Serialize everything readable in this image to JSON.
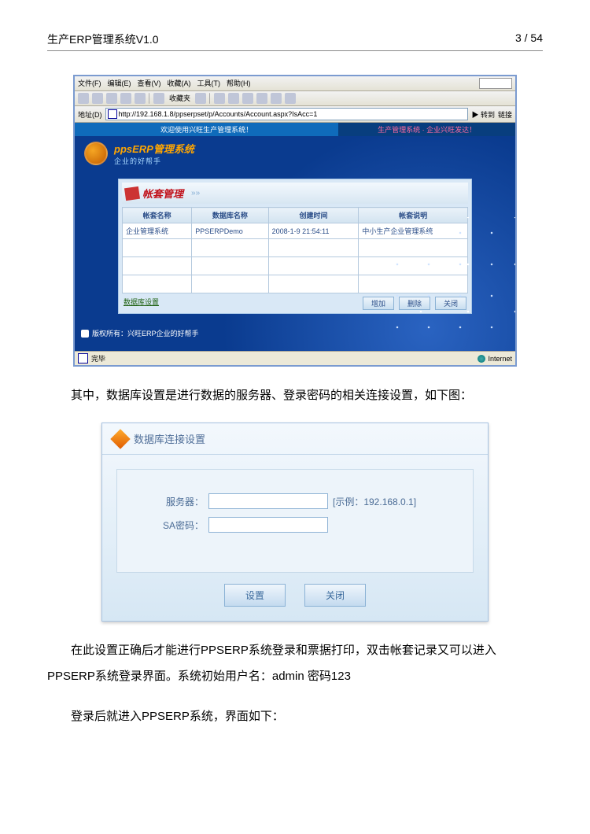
{
  "page_header": {
    "title": "生产ERP管理系统V1.0",
    "page_of": "3 / 54"
  },
  "ie": {
    "menus": [
      "文件(F)",
      "编辑(E)",
      "查看(V)",
      "收藏(A)",
      "工具(T)",
      "帮助(H)"
    ],
    "favorites_label": "收藏夹",
    "address_label": "地址(D)",
    "url": "http://192.168.1.8/ppserpset/p/Accounts/Account.aspx?IsAcc=1",
    "go_label": "转到",
    "links_label": "链接",
    "banner_left": "欢迎使用兴旺生产管理系统！",
    "banner_right": "生产管理系统 · 企业兴旺发达！",
    "brand_main": "ppsERP管理系统",
    "brand_sub": "企业的好帮手",
    "panel_title": "帐套管理",
    "table": {
      "headers": [
        "帐套名称",
        "数据库名称",
        "创建时间",
        "帐套说明"
      ],
      "row": {
        "account_name": "企业管理系统",
        "db_name": "PPSERPDemo",
        "created": "2008-1-9 21:54:11",
        "desc": "中小生产企业管理系统"
      }
    },
    "bottom_link": "数据库设置",
    "buttons": {
      "add": "增加",
      "delete": "删除",
      "close": "关闭"
    },
    "copyright": "版权所有：兴旺ERP企业的好帮手",
    "status_done": "完毕",
    "status_zone": "Internet"
  },
  "paragraphs": {
    "p1": "其中，数据库设置是进行数据的服务器、登录密码的相关连接设置，如下图：",
    "p2": "在此设置正确后才能进行PPSERP系统登录和票据打印，双击帐套记录又可以进入PPSERP系统登录界面。系统初始用户名：admin 密码123",
    "p3": "登录后就进入PPSERP系统，界面如下："
  },
  "db_dialog": {
    "title": "数据库连接设置",
    "server_label": "服务器：",
    "server_hint": "[示例：192.168.0.1]",
    "pwd_label": "SA密码：",
    "btn_set": "设置",
    "btn_close": "关闭"
  }
}
